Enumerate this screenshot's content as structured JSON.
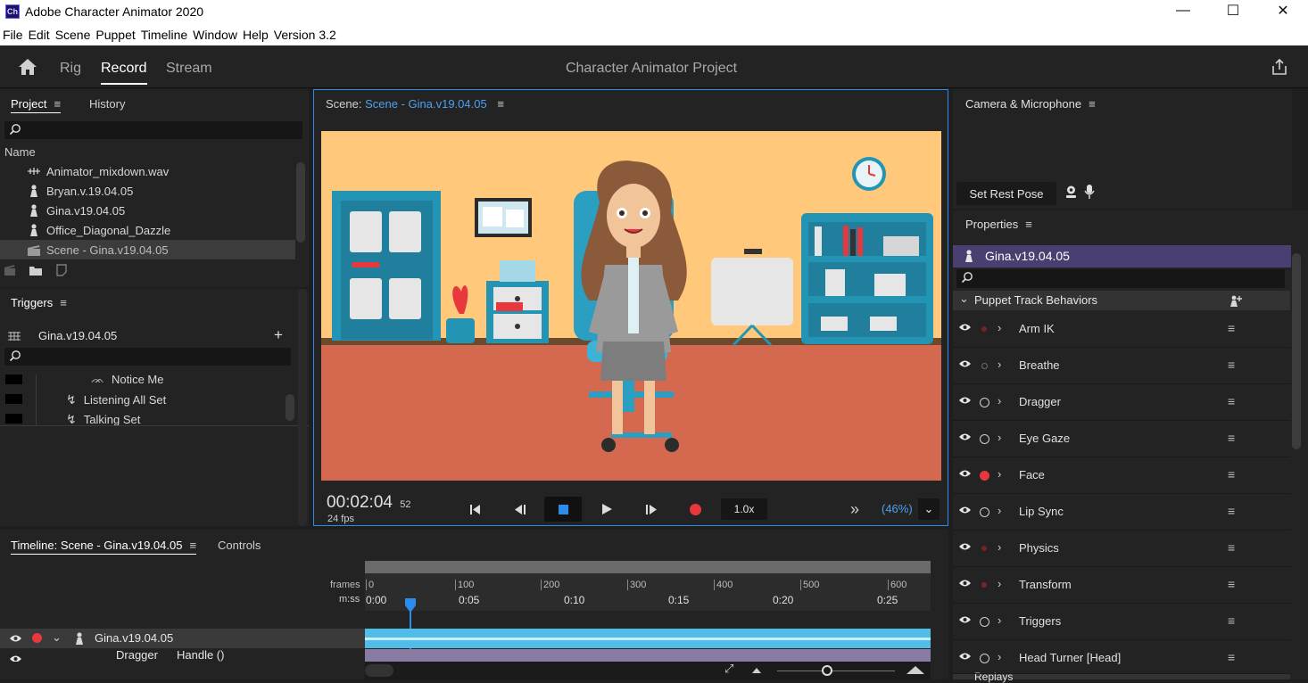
{
  "window": {
    "app_icon_text": "Ch",
    "title": "Adobe Character Animator 2020",
    "minimize": "—",
    "maximize": "☐",
    "close": "✕"
  },
  "menu": [
    "File",
    "Edit",
    "Scene",
    "Puppet",
    "Timeline",
    "Window",
    "Help",
    "Version 3.2"
  ],
  "modes": {
    "rig": "Rig",
    "record": "Record",
    "stream": "Stream",
    "active": "Record"
  },
  "project_title": "Character Animator Project",
  "project_panel": {
    "tab_project": "Project",
    "tab_history": "History",
    "menu_glyph": "≡",
    "column_name": "Name",
    "items": [
      {
        "icon": "audio-icon",
        "label": "Animator_mixdown.wav"
      },
      {
        "icon": "puppet-icon",
        "label": "Bryan.v.19.04.05"
      },
      {
        "icon": "puppet-icon",
        "label": "Gina.v19.04.05"
      },
      {
        "icon": "puppet-icon",
        "label": "Office_Diagonal_Dazzle"
      },
      {
        "icon": "scene-icon",
        "label": "Scene - Gina.v19.04.05",
        "selected": true
      }
    ]
  },
  "triggers_panel": {
    "title": "Triggers",
    "menu_glyph": "≡",
    "puppet": "Gina.v19.04.05",
    "add": "+",
    "items": [
      "Notice Me",
      "Listening All Set",
      "Talking Set"
    ]
  },
  "scene_panel": {
    "prefix": "Scene:",
    "name": "Scene - Gina.v19.04.05",
    "menu_glyph": "≡",
    "timecode": "00:02:04",
    "frame": "52",
    "fps": "24 fps",
    "speed": "1.0x",
    "zoom": "(46%)",
    "more": "»",
    "zoom_caret": "⌄"
  },
  "timeline_panel": {
    "tab_timeline": "Timeline: Scene - Gina.v19.04.05",
    "menu_glyph": "≡",
    "tab_controls": "Controls",
    "frames_label": "frames",
    "mss_label": "m:ss",
    "frame_ticks": [
      "0",
      "100",
      "200",
      "300",
      "400",
      "500",
      "600"
    ],
    "time_ticks": [
      "0:00",
      "0:05",
      "0:10",
      "0:15",
      "0:20",
      "0:25"
    ],
    "track_puppet": "Gina.v19.04.05",
    "sub_track": "Dragger",
    "sub_track_handle": "Handle ()"
  },
  "camera_panel": {
    "title": "Camera & Microphone",
    "menu_glyph": "≡",
    "set_rest_pose": "Set Rest Pose"
  },
  "properties_panel": {
    "title": "Properties",
    "menu_glyph": "≡",
    "puppet": "Gina.v19.04.05",
    "section": "Puppet Track Behaviors",
    "section_bottom": "Replays",
    "behaviors": [
      {
        "label": "Arm IK",
        "armed": "dim-red"
      },
      {
        "label": "Breathe",
        "armed": "dim-ring"
      },
      {
        "label": "Dragger",
        "armed": "ring"
      },
      {
        "label": "Eye Gaze",
        "armed": "ring"
      },
      {
        "label": "Face",
        "armed": "red"
      },
      {
        "label": "Lip Sync",
        "armed": "ring"
      },
      {
        "label": "Physics",
        "armed": "dim-red"
      },
      {
        "label": "Transform",
        "armed": "dim-red"
      },
      {
        "label": "Triggers",
        "armed": "ring"
      },
      {
        "label": "Head Turner [Head]",
        "armed": "ring"
      }
    ]
  },
  "colors": {
    "accent": "#2d8ceb",
    "scene_wall": "#ffc87a",
    "scene_floor": "#d5694f",
    "track_blue": "#4fbde8",
    "puppet_header": "#4b3f72",
    "record_red": "#e8383d"
  }
}
